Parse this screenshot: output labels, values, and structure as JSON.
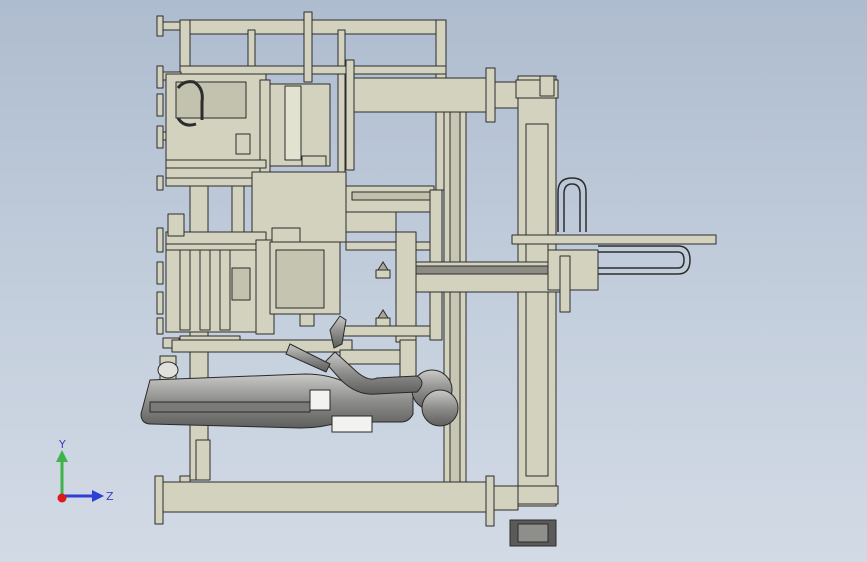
{
  "viewport": {
    "background_top": "#aebccf",
    "background_bottom": "#d2dae5"
  },
  "model": {
    "fill_color": "#d2d2bf",
    "edge_color": "#2c2c2c",
    "mannequin_color": "#9a9a98"
  },
  "triad": {
    "y_label": "Y",
    "z_label": "Z",
    "y_color": "#3fb24a",
    "z_color": "#2f3ed6",
    "x_color": "#d81c1c"
  }
}
